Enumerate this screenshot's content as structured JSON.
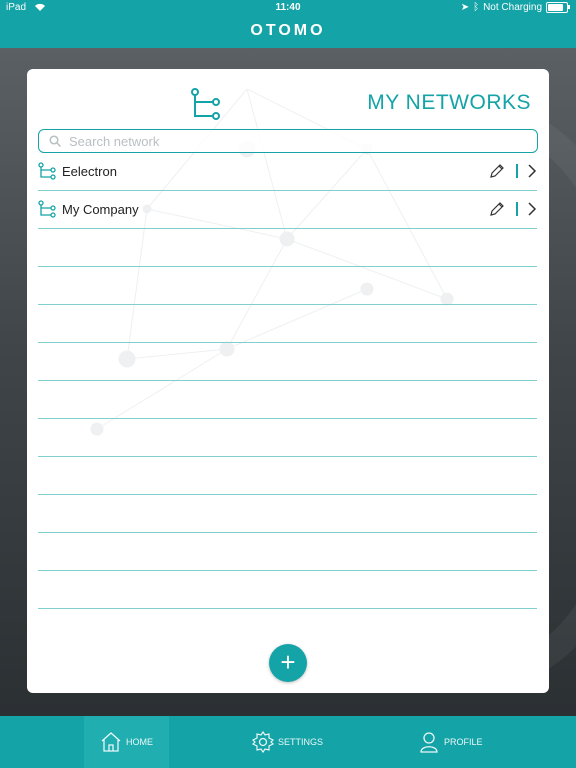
{
  "status_bar": {
    "device": "iPad",
    "time": "11:40",
    "charging_text": "Not Charging",
    "battery_level": 0.85
  },
  "header": {
    "brand": "OTOMO"
  },
  "page": {
    "title": "MY NETWORKS",
    "header_icon": "network-tree-icon"
  },
  "search": {
    "placeholder": "Search network",
    "value": ""
  },
  "networks": [
    {
      "name": "Eelectron",
      "icon": "network-tree-icon",
      "edit_icon": "pencil-icon",
      "go_icon": "chevron-right-icon"
    },
    {
      "name": "My Company",
      "icon": "network-tree-icon",
      "edit_icon": "pencil-icon",
      "go_icon": "chevron-right-icon"
    }
  ],
  "empty_rows": 10,
  "actions": {
    "add_symbol": "+"
  },
  "tabs": [
    {
      "label": "HOME",
      "icon": "home-icon",
      "active": true
    },
    {
      "label": "SETTINGS",
      "icon": "gear-icon",
      "active": false
    },
    {
      "label": "PROFILE",
      "icon": "user-icon",
      "active": false
    }
  ],
  "colors": {
    "accent": "#14a3a6",
    "background_dark": "#2e3438",
    "panel": "#ffffff"
  }
}
